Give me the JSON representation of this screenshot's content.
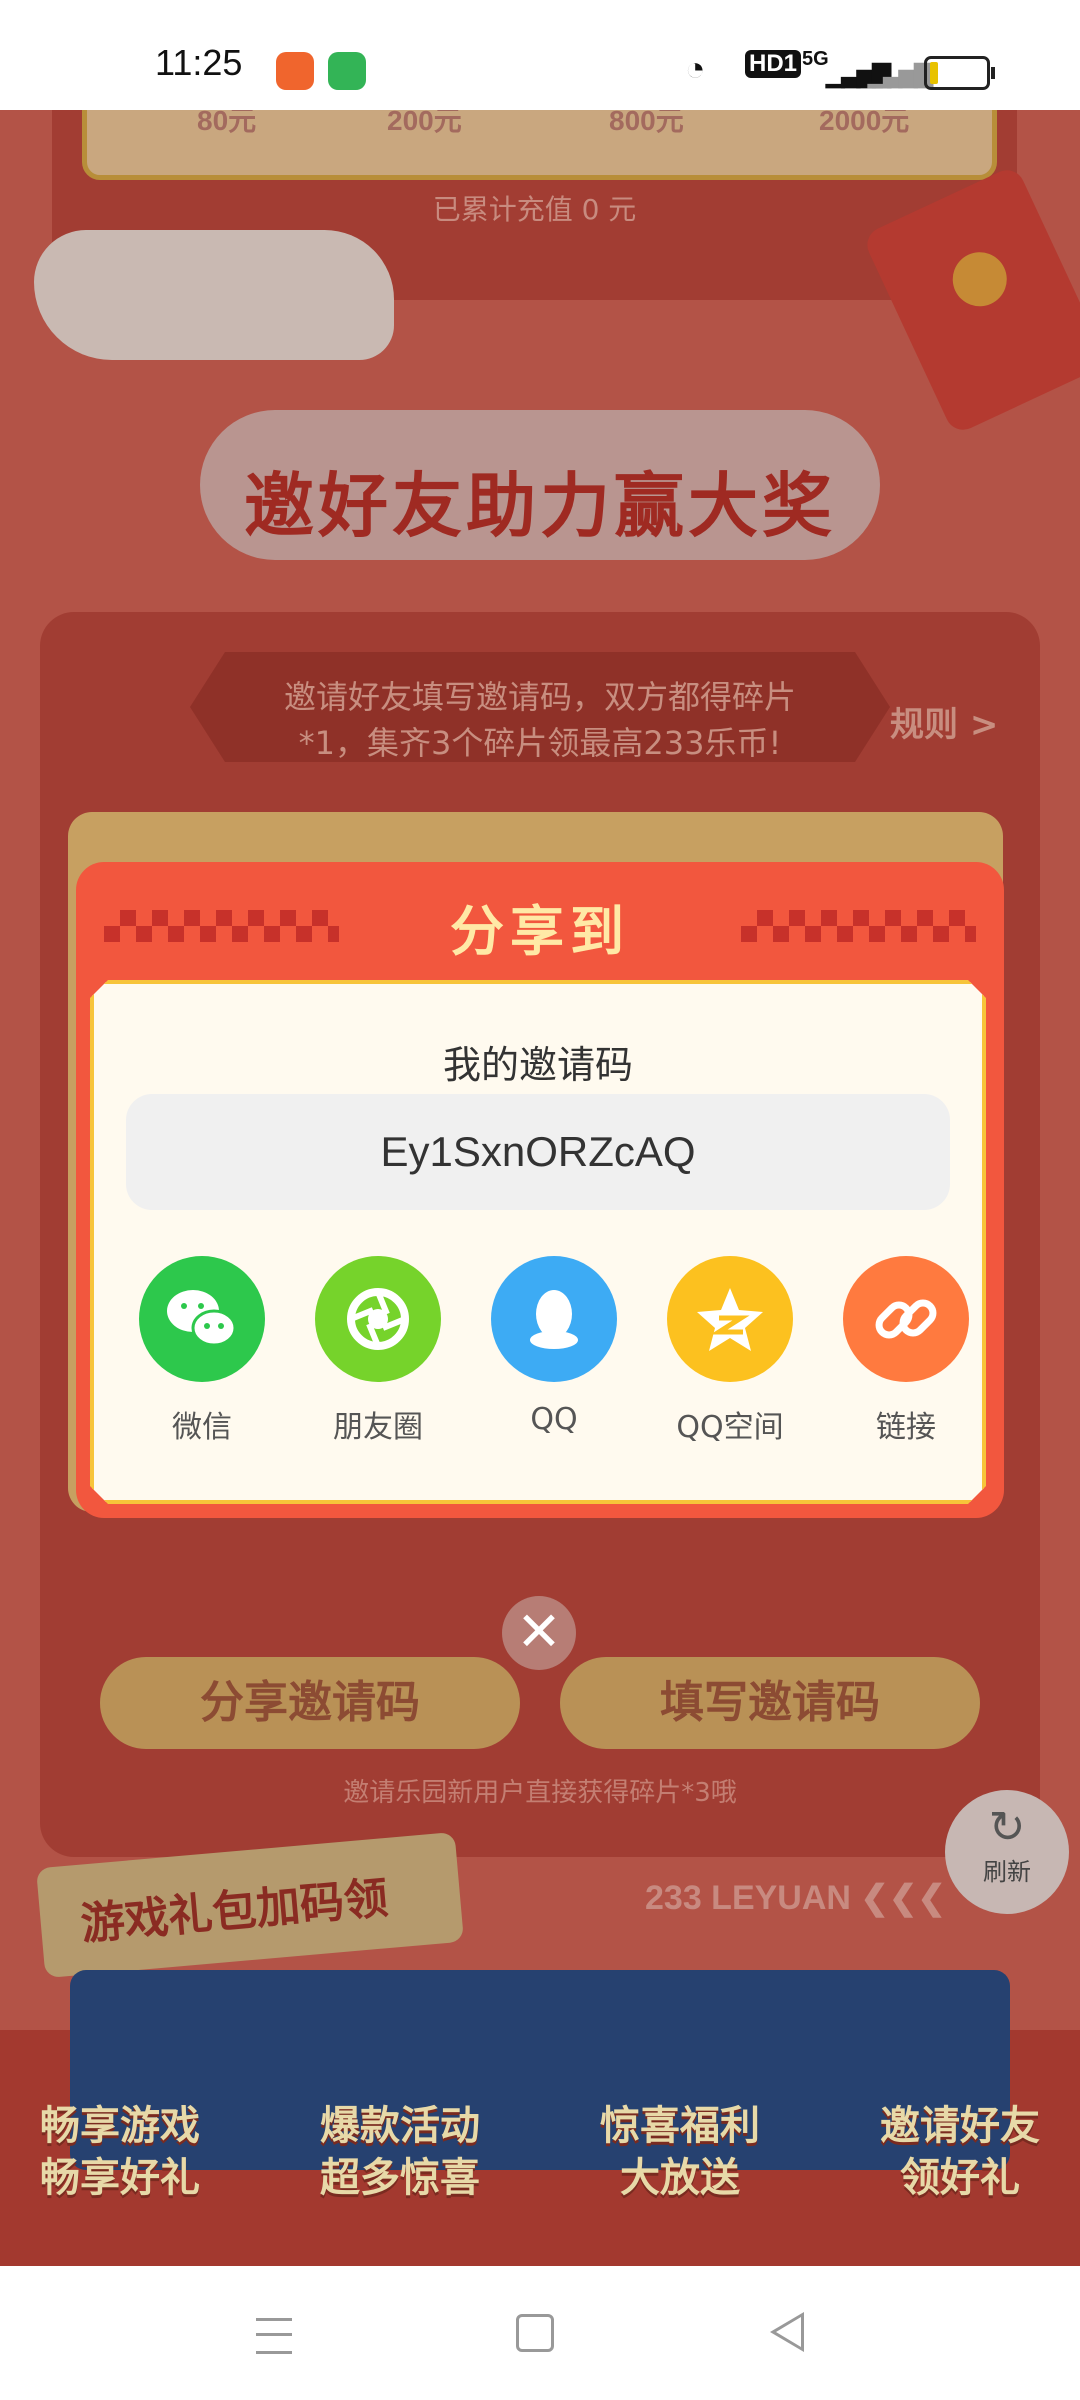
{
  "status_bar": {
    "time": "11:25",
    "network": "HD1",
    "cellular": "5G",
    "battery_level": 0.12
  },
  "recharge": {
    "tiers": [
      "80元",
      "200元",
      "800元",
      "2000元"
    ],
    "accumulated": "已累计充值 0 元"
  },
  "invite_section": {
    "title": "邀好友助力赢大奖",
    "rule_text_line1": "邀请好友填写邀请码，双方都得碎片",
    "rule_text_line2": "*1，集齐3个碎片领最高233乐币!",
    "rules_link": "规则 >",
    "share_code_button": "分享邀请码",
    "fill_code_button": "填写邀请码",
    "hint": "邀请乐园新用户直接获得碎片*3哦"
  },
  "gift_section": {
    "title": "游戏礼包加码领",
    "brand": "233 LEYUAN"
  },
  "refresh": {
    "label": "刷新"
  },
  "promo_items": [
    {
      "line1": "畅享游戏",
      "line2": "畅享好礼"
    },
    {
      "line1": "爆款活动",
      "line2": "超多惊喜"
    },
    {
      "line1": "惊喜福利",
      "line2": "大放送"
    },
    {
      "line1": "邀请好友",
      "line2": "领好礼"
    }
  ],
  "dialog": {
    "title": "分享到",
    "code_label": "我的邀请码",
    "invite_code": "Ey1SxnORZcAQ",
    "share_options": [
      {
        "label": "微信",
        "icon": "wechat-icon",
        "color": "#2dc84c"
      },
      {
        "label": "朋友圈",
        "icon": "moments-icon",
        "color": "#76d32b"
      },
      {
        "label": "QQ",
        "icon": "qq-icon",
        "color": "#3dabf4"
      },
      {
        "label": "QQ空间",
        "icon": "qzone-icon",
        "color": "#fcc11f"
      },
      {
        "label": "链接",
        "icon": "link-icon",
        "color": "#ff7a3f"
      }
    ]
  },
  "colors": {
    "dialog": "#f2573e",
    "dialog_title": "#ffe9a6",
    "dialog_body": "#fffaef"
  }
}
